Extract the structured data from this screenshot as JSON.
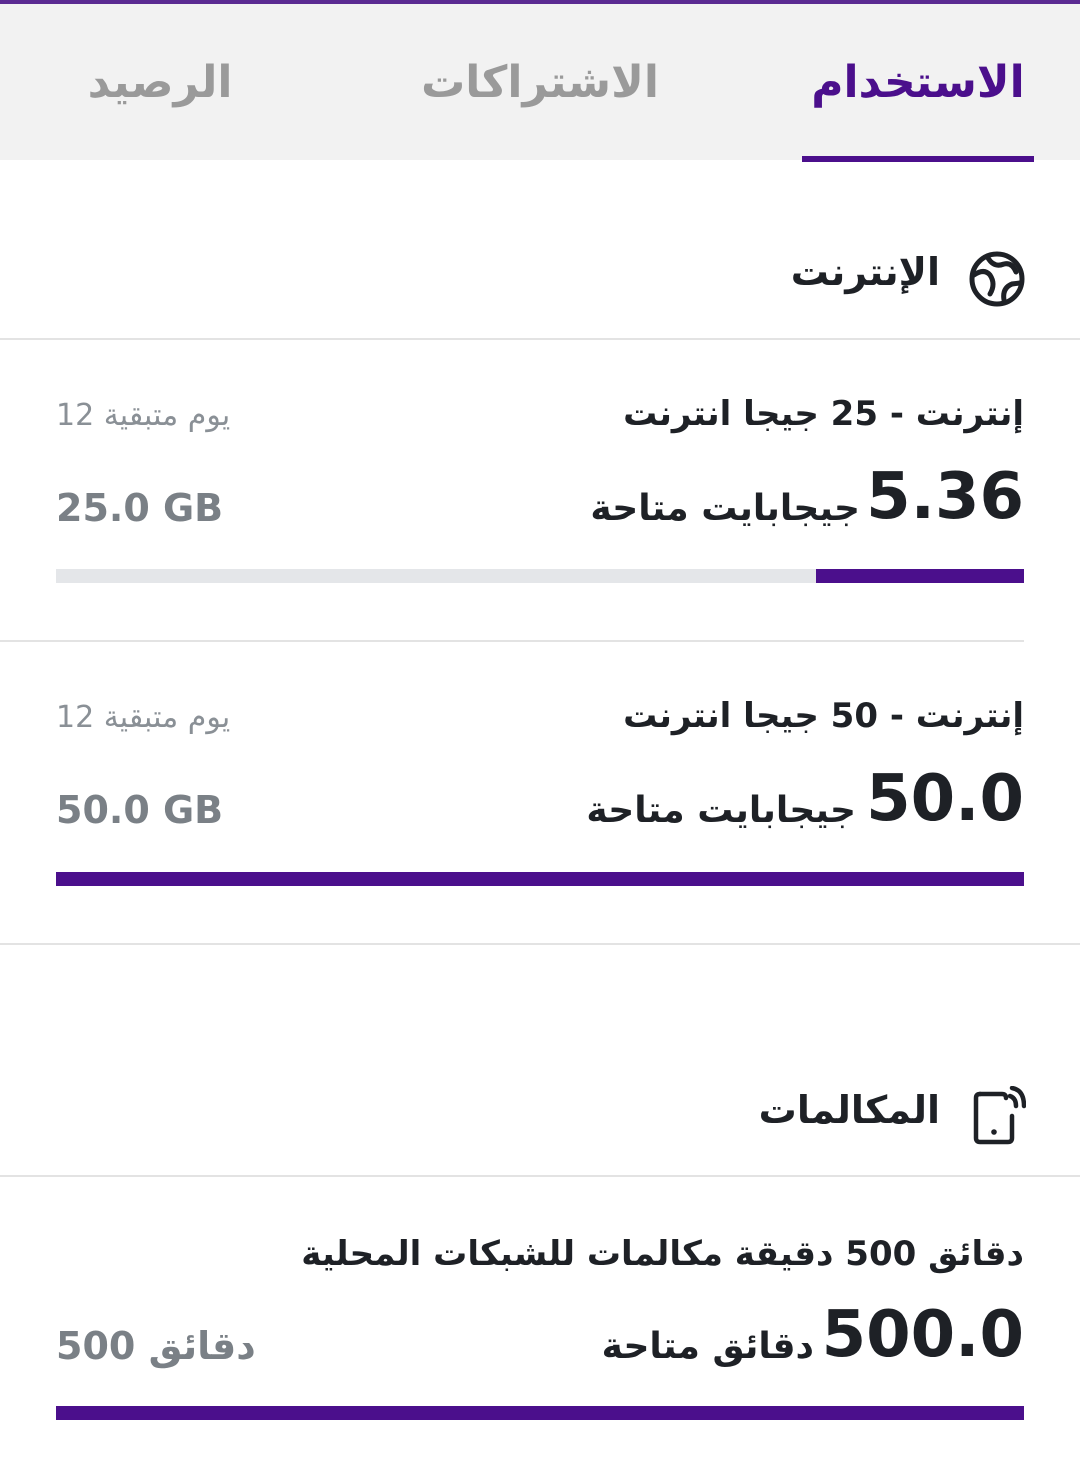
{
  "tabs": {
    "usage": "الاستخدام",
    "subscriptions": "الاشتراكات",
    "balance": "الرصيد",
    "active": "usage"
  },
  "colors": {
    "accent": "#4b0f8c",
    "tab_inactive": "#9a9a9a",
    "track": "#e4e6e9",
    "muted_text": "#8a9096"
  },
  "internet": {
    "title": "الإنترنت",
    "icon": "globe-icon",
    "items": [
      {
        "title": "إنترنت - 25 جيجا انترنت",
        "days_left": "12 يوم متبقية",
        "amount": "5.36",
        "unit": "جيجابايت متاحة",
        "total": "25.0 GB",
        "remaining_fraction": 0.2144
      },
      {
        "title": "إنترنت - 50 جيجا انترنت",
        "days_left": "12 يوم متبقية",
        "amount": "50.0",
        "unit": "جيجابايت متاحة",
        "total": "50.0 GB",
        "remaining_fraction": 1.0
      }
    ]
  },
  "calls": {
    "title": "المكالمات",
    "icon": "phone-call-icon",
    "items": [
      {
        "title": "دقائق 500 دقيقة مكالمات للشبكات المحلية",
        "amount": "500.0",
        "unit": "دقائق متاحة",
        "total": "500 دقائق",
        "remaining_fraction": 1.0
      }
    ]
  }
}
